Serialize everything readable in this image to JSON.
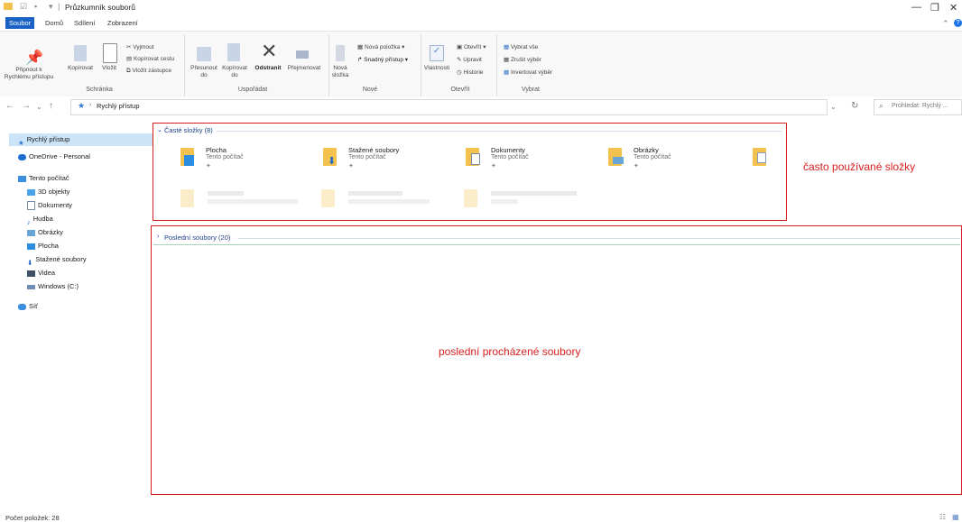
{
  "window": {
    "title": "Průzkumník souborů",
    "controls": [
      "—",
      "❐",
      "✕"
    ]
  },
  "ribbon_tabs": [
    "Soubor",
    "Domů",
    "Sdílení",
    "Zobrazení"
  ],
  "ribbon": {
    "schranka": {
      "label": "Schránka",
      "pin_label": "Připnout k Rychlému přístupu",
      "copy_label": "Kopírovat",
      "paste_label": "Vložit",
      "cut": "Vyjmout",
      "copy_path": "Kopírovat cestu",
      "paste_shortcut": "Vložit zástupce"
    },
    "usporadat": {
      "label": "Uspořádat",
      "move_label": "Přesunout do",
      "copyto_label": "Kopírovat do",
      "delete_label": "Odstranit",
      "rename_label": "Přejmenovat"
    },
    "nove": {
      "label": "Nové",
      "new_folder": "Nová složka",
      "new_item": "Nová položka",
      "easy_access": "Snadný přístup"
    },
    "otevrit": {
      "label": "Otevřít",
      "properties": "Vlastnosti",
      "open": "Otevřít",
      "edit": "Upravit",
      "history": "Historie"
    },
    "vybrat": {
      "label": "Vybrat",
      "select_all": "Vybrat vše",
      "select_none": "Zrušit výběr",
      "invert": "Invertovat výběr"
    }
  },
  "address": {
    "path": "Rychlý přístup",
    "search_placeholder": "Prohledat: Rychlý ..."
  },
  "sidebar": {
    "items": [
      {
        "label": "Rychlý přístup",
        "icon": "star-icon"
      },
      {
        "label": "OneDrive - Personal",
        "icon": "cloud-icon"
      },
      {
        "label": "Tento počítač",
        "icon": "computer-icon"
      },
      {
        "label": "3D objekty",
        "icon": "cube-icon"
      },
      {
        "label": "Dokumenty",
        "icon": "document-icon"
      },
      {
        "label": "Hudba",
        "icon": "music-icon"
      },
      {
        "label": "Obrázky",
        "icon": "picture-icon"
      },
      {
        "label": "Plocha",
        "icon": "desktop-icon"
      },
      {
        "label": "Stažené soubory",
        "icon": "download-icon"
      },
      {
        "label": "Videa",
        "icon": "video-icon"
      },
      {
        "label": "Windows (C:)",
        "icon": "drive-icon"
      },
      {
        "label": "Síť",
        "icon": "network-icon"
      }
    ]
  },
  "frequent": {
    "title": "Časté složky (8)",
    "folders": [
      {
        "name": "Plocha",
        "sub": "Tento počítač"
      },
      {
        "name": "Stažené soubory",
        "sub": "Tento počítač"
      },
      {
        "name": "Dokumenty",
        "sub": "Tento počítač"
      },
      {
        "name": "Obrázky",
        "sub": "Tento počítač"
      }
    ]
  },
  "recent": {
    "title": "Poslední soubory (20)"
  },
  "annotations": {
    "frequent": "často používané složky",
    "recent": "poslední procházené soubory"
  },
  "status": {
    "count": "Počet položek: 28"
  },
  "colors": {
    "accent": "#1a63c4",
    "annotation": "#d71e1e",
    "selection": "#cce4f7",
    "folder": "#f2c14e"
  }
}
